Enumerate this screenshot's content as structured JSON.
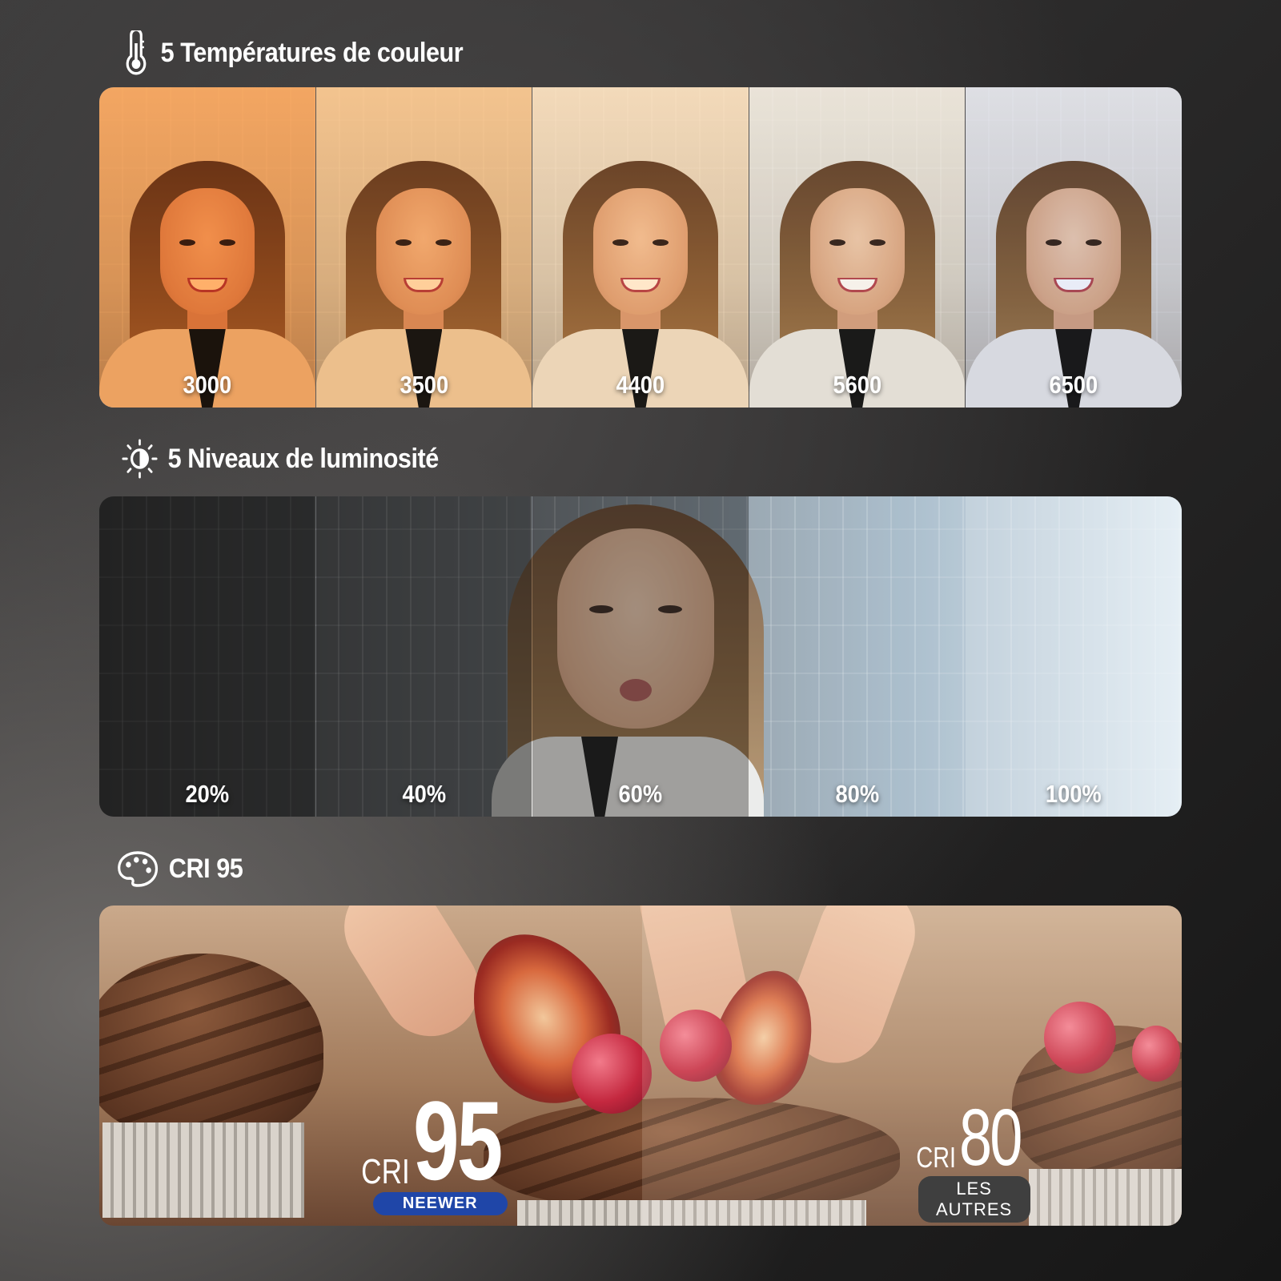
{
  "temperature_section": {
    "title": "5 Températures de couleur",
    "icon": "thermometer-icon",
    "items": [
      {
        "label": "3000",
        "tint": "#ffb06a"
      },
      {
        "label": "3500",
        "tint": "#ffcf9a"
      },
      {
        "label": "4400",
        "tint": "#ffe7c9"
      },
      {
        "label": "5600",
        "tint": "#f6f1ea"
      },
      {
        "label": "6500",
        "tint": "#e9ecf7"
      }
    ]
  },
  "brightness_section": {
    "title": "5 Niveaux de luminosité",
    "icon": "brightness-icon",
    "items": [
      {
        "label": "20%",
        "level": 0.2
      },
      {
        "label": "40%",
        "level": 0.4
      },
      {
        "label": "60%",
        "level": 0.6
      },
      {
        "label": "80%",
        "level": 0.8
      },
      {
        "label": "100%",
        "level": 1.0
      }
    ]
  },
  "cri_section": {
    "title": "CRI 95",
    "icon": "palette-icon",
    "left": {
      "prefix": "CRI",
      "value": "95",
      "tag": "NEEWER",
      "tag_color": "#1f46a8"
    },
    "right": {
      "prefix": "CRI",
      "value": "80",
      "tag": "LES AUTRES",
      "tag_color": "#3f3f3f"
    }
  }
}
